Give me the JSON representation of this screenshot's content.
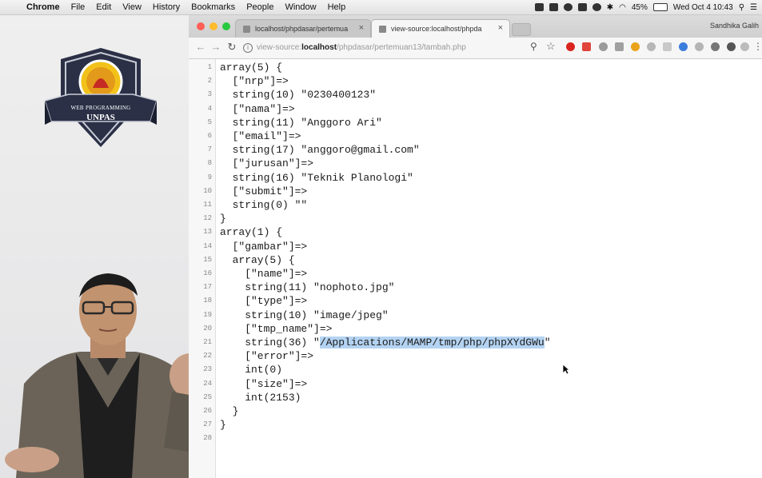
{
  "menubar": {
    "items": [
      "Chrome",
      "File",
      "Edit",
      "View",
      "History",
      "Bookmarks",
      "People",
      "Window",
      "Help"
    ],
    "battery": "45%",
    "clock": "Wed Oct 4  10:43"
  },
  "logo": {
    "line1": "WEB PROGRAMMING",
    "line2": "UNPAS"
  },
  "browser": {
    "tabs": [
      {
        "label": "localhost/phpdasar/pertemua",
        "close": "×"
      },
      {
        "label": "view-source:localhost/phpda",
        "close": "×"
      }
    ],
    "profile_name": "Sandhika Galih",
    "url": {
      "scheme": "view-source:",
      "host": "localhost",
      "path": "/phpdasar/pertemuan13/tambah.php"
    }
  },
  "source": {
    "lines": [
      "array(5) {",
      "  [\"nrp\"]=>",
      "  string(10) \"0230400123\"",
      "  [\"nama\"]=>",
      "  string(11) \"Anggoro Ari\"",
      "  [\"email\"]=>",
      "  string(17) \"anggoro@gmail.com\"",
      "  [\"jurusan\"]=>",
      "  string(16) \"Teknik Planologi\"",
      "  [\"submit\"]=>",
      "  string(0) \"\"",
      "}",
      "array(1) {",
      "  [\"gambar\"]=>",
      "  array(5) {",
      "    [\"name\"]=>",
      "    string(11) \"nophoto.jpg\"",
      "    [\"type\"]=>",
      "    string(10) \"image/jpeg\"",
      "    [\"tmp_name\"]=>",
      "    string(36) \"/Applications/MAMP/tmp/php/phpXYdGWu\"",
      "    [\"error\"]=>",
      "    int(0)",
      "    [\"size\"]=>",
      "    int(2153)",
      "  }",
      "}",
      ""
    ],
    "highlight_prefix": "    string(36) \"",
    "highlight_text": "/Applications/MAMP/tmp/php/phpXYdGWu",
    "highlight_suffix": "\""
  }
}
